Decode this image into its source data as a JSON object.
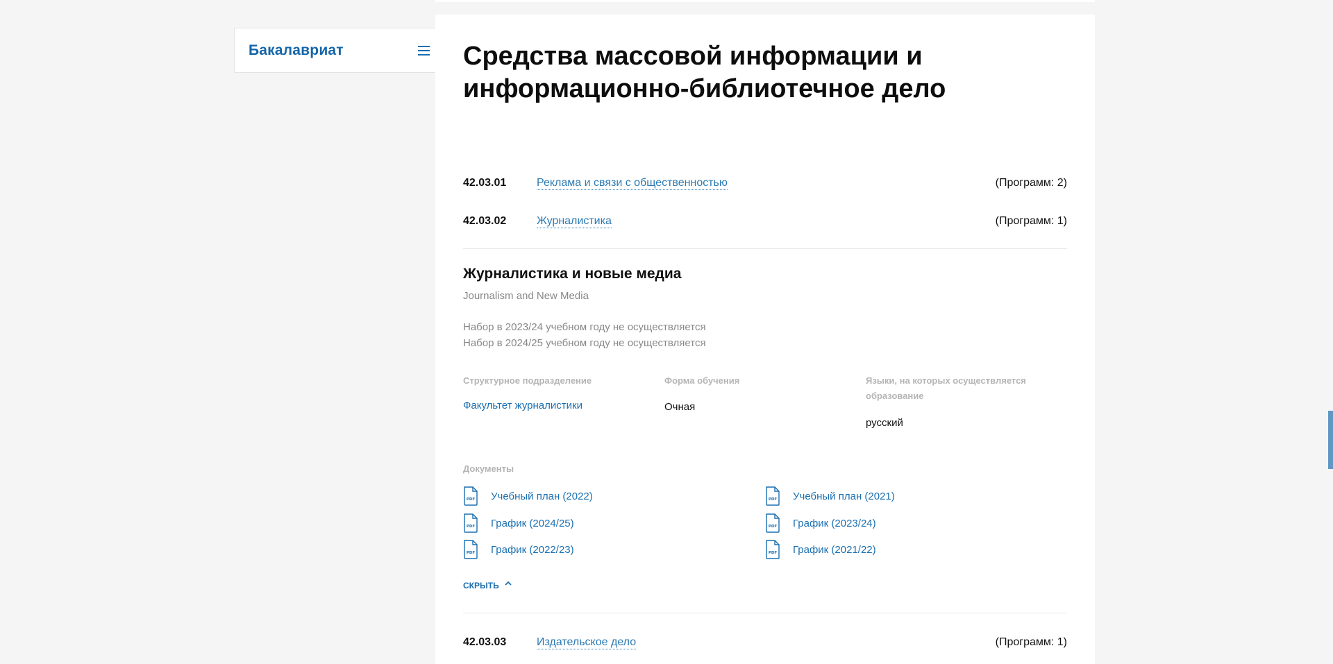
{
  "sidebar": {
    "title": "Бакалавриат",
    "menu_icon": "hamburger-icon"
  },
  "main": {
    "title": "Средства массовой информации и информационно-библиотечное дело",
    "specialties": [
      {
        "code": "42.03.01",
        "name": "Реклама и связи с общественностью",
        "count": "(Программ: 2)"
      },
      {
        "code": "42.03.02",
        "name": "Журналистика",
        "count": "(Программ: 1)"
      },
      {
        "code": "42.03.03",
        "name": "Издательское дело",
        "count": "(Программ: 1)"
      }
    ],
    "program": {
      "title": "Журналистика и новые медиа",
      "subtitle": "Journalism and New Media",
      "notes": [
        "Набор в 2023/24 учебном году не осуществляется",
        "Набор в 2024/25 учебном году не осуществляется"
      ],
      "columns": {
        "department": {
          "label": "Структурное подразделение",
          "value": "Факультет журналистики"
        },
        "study_form": {
          "label": "Форма обучения",
          "value": "Очная"
        },
        "languages": {
          "label": "Языки, на которых осуществляется образование",
          "value": "русский"
        }
      },
      "documents_label": "Документы",
      "documents": [
        {
          "label": "Учебный план (2022)",
          "icon": "pdf-file-icon"
        },
        {
          "label": "Учебный план (2021)",
          "icon": "pdf-file-icon"
        },
        {
          "label": "График (2024/25)",
          "icon": "pdf-file-icon"
        },
        {
          "label": "График (2023/24)",
          "icon": "pdf-file-icon"
        },
        {
          "label": "График (2022/23)",
          "icon": "pdf-file-icon"
        },
        {
          "label": "График (2021/22)",
          "icon": "pdf-file-icon"
        }
      ],
      "hide_label": "СКРЫТЬ",
      "hide_icon": "chevron-up-icon"
    }
  },
  "colors": {
    "accent": "#1a6fb0",
    "link": "#2b7ab3",
    "muted": "#888888",
    "label": "#b5b5b5",
    "background": "#f5f5f5"
  }
}
